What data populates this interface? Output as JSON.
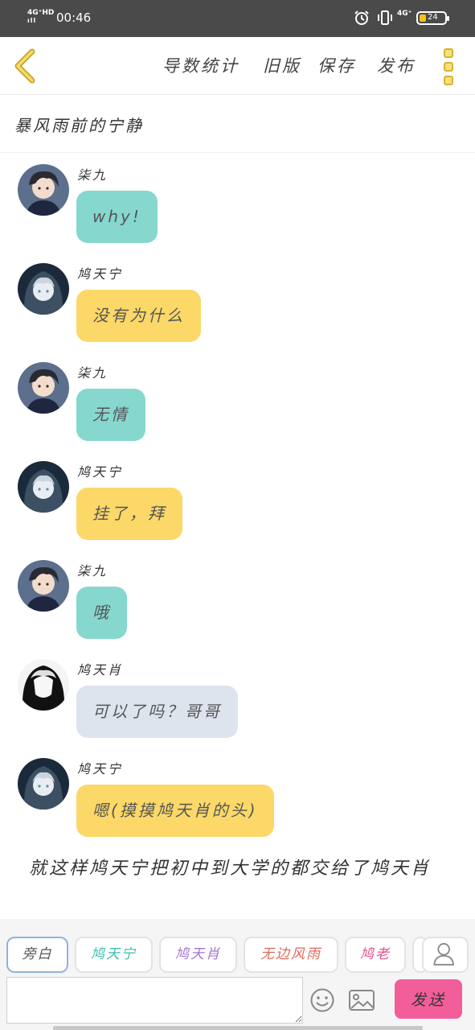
{
  "status_bar": {
    "network_left": "4G⁺HD",
    "signal": "ıll",
    "time": "00:46",
    "network_right": "4G⁺",
    "battery": "24"
  },
  "header": {
    "actions": {
      "stats": "导数统计",
      "old_version": "旧版",
      "save": "保存",
      "publish": "发布"
    }
  },
  "story": {
    "title": "暴风雨前的宁静"
  },
  "messages": [
    {
      "sender": "柒九",
      "text": "why!",
      "color": "#86d8cf"
    },
    {
      "sender": "鸠天宁",
      "text": "没有为什么",
      "color": "#fbd868"
    },
    {
      "sender": "柒九",
      "text": "无情",
      "color": "#86d8cf"
    },
    {
      "sender": "鸠天宁",
      "text": "挂了，拜",
      "color": "#fbd868"
    },
    {
      "sender": "柒九",
      "text": "哦",
      "color": "#86d8cf"
    },
    {
      "sender": "鸠天肖",
      "text": "可以了吗？哥哥",
      "color": "#dde4ee"
    },
    {
      "sender": "鸠天宁",
      "text": "嗯(摸摸鸠天肖的头)",
      "color": "#fbd868"
    }
  ],
  "narration": "就这样鸠天宁把初中到大学的都交给了鸠天肖",
  "roles": [
    {
      "label": "旁白",
      "color": "#555555"
    },
    {
      "label": "鸠天宁",
      "color": "#3cbcae"
    },
    {
      "label": "鸠天肖",
      "color": "#a274d6"
    },
    {
      "label": "无边风雨",
      "color": "#e06a5a"
    },
    {
      "label": "鸠老",
      "color": "#e0548f"
    }
  ],
  "composer": {
    "placeholder": "",
    "send_label": "发送"
  },
  "colors": {
    "teal_bubble": "#86d8cf",
    "yellow_bubble": "#fbd868",
    "gray_bubble": "#dde4ee",
    "send_button": "#f25e9a",
    "accent_yellow": "#f5c21b"
  }
}
